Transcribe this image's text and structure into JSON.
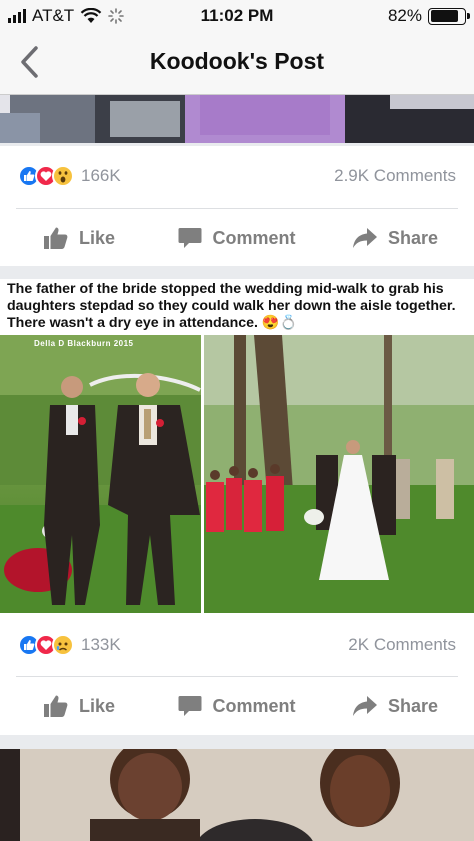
{
  "status_bar": {
    "carrier": "AT&T",
    "time": "11:02 PM",
    "battery": "82%",
    "battery_level": 0.82
  },
  "nav": {
    "title": "Koodook's Post",
    "back_icon": "chevron-left-icon"
  },
  "posts": [
    {
      "reactions": [
        "like",
        "love",
        "wow"
      ],
      "reaction_count": "166K",
      "comments": "2.9K Comments",
      "actions": {
        "like": "Like",
        "comment": "Comment",
        "share": "Share"
      }
    },
    {
      "caption": "The father of the bride stopped the wedding mid-walk to grab his daughters stepdad so they could walk her down the aisle together. There wasn't a dry eye in attendance. 😍💍",
      "watermark": "Della D Blackburn 2015",
      "reactions": [
        "like",
        "love",
        "sad"
      ],
      "reaction_count": "133K",
      "comments": "2K Comments",
      "actions": {
        "like": "Like",
        "comment": "Comment",
        "share": "Share"
      }
    }
  ],
  "colors": {
    "like": "#1877f2",
    "love": "#f0284a",
    "wow": "#f7c23e",
    "action_text": "#7f7f7f",
    "meta_text": "#90949c",
    "feed_bg": "#e9ebee"
  }
}
